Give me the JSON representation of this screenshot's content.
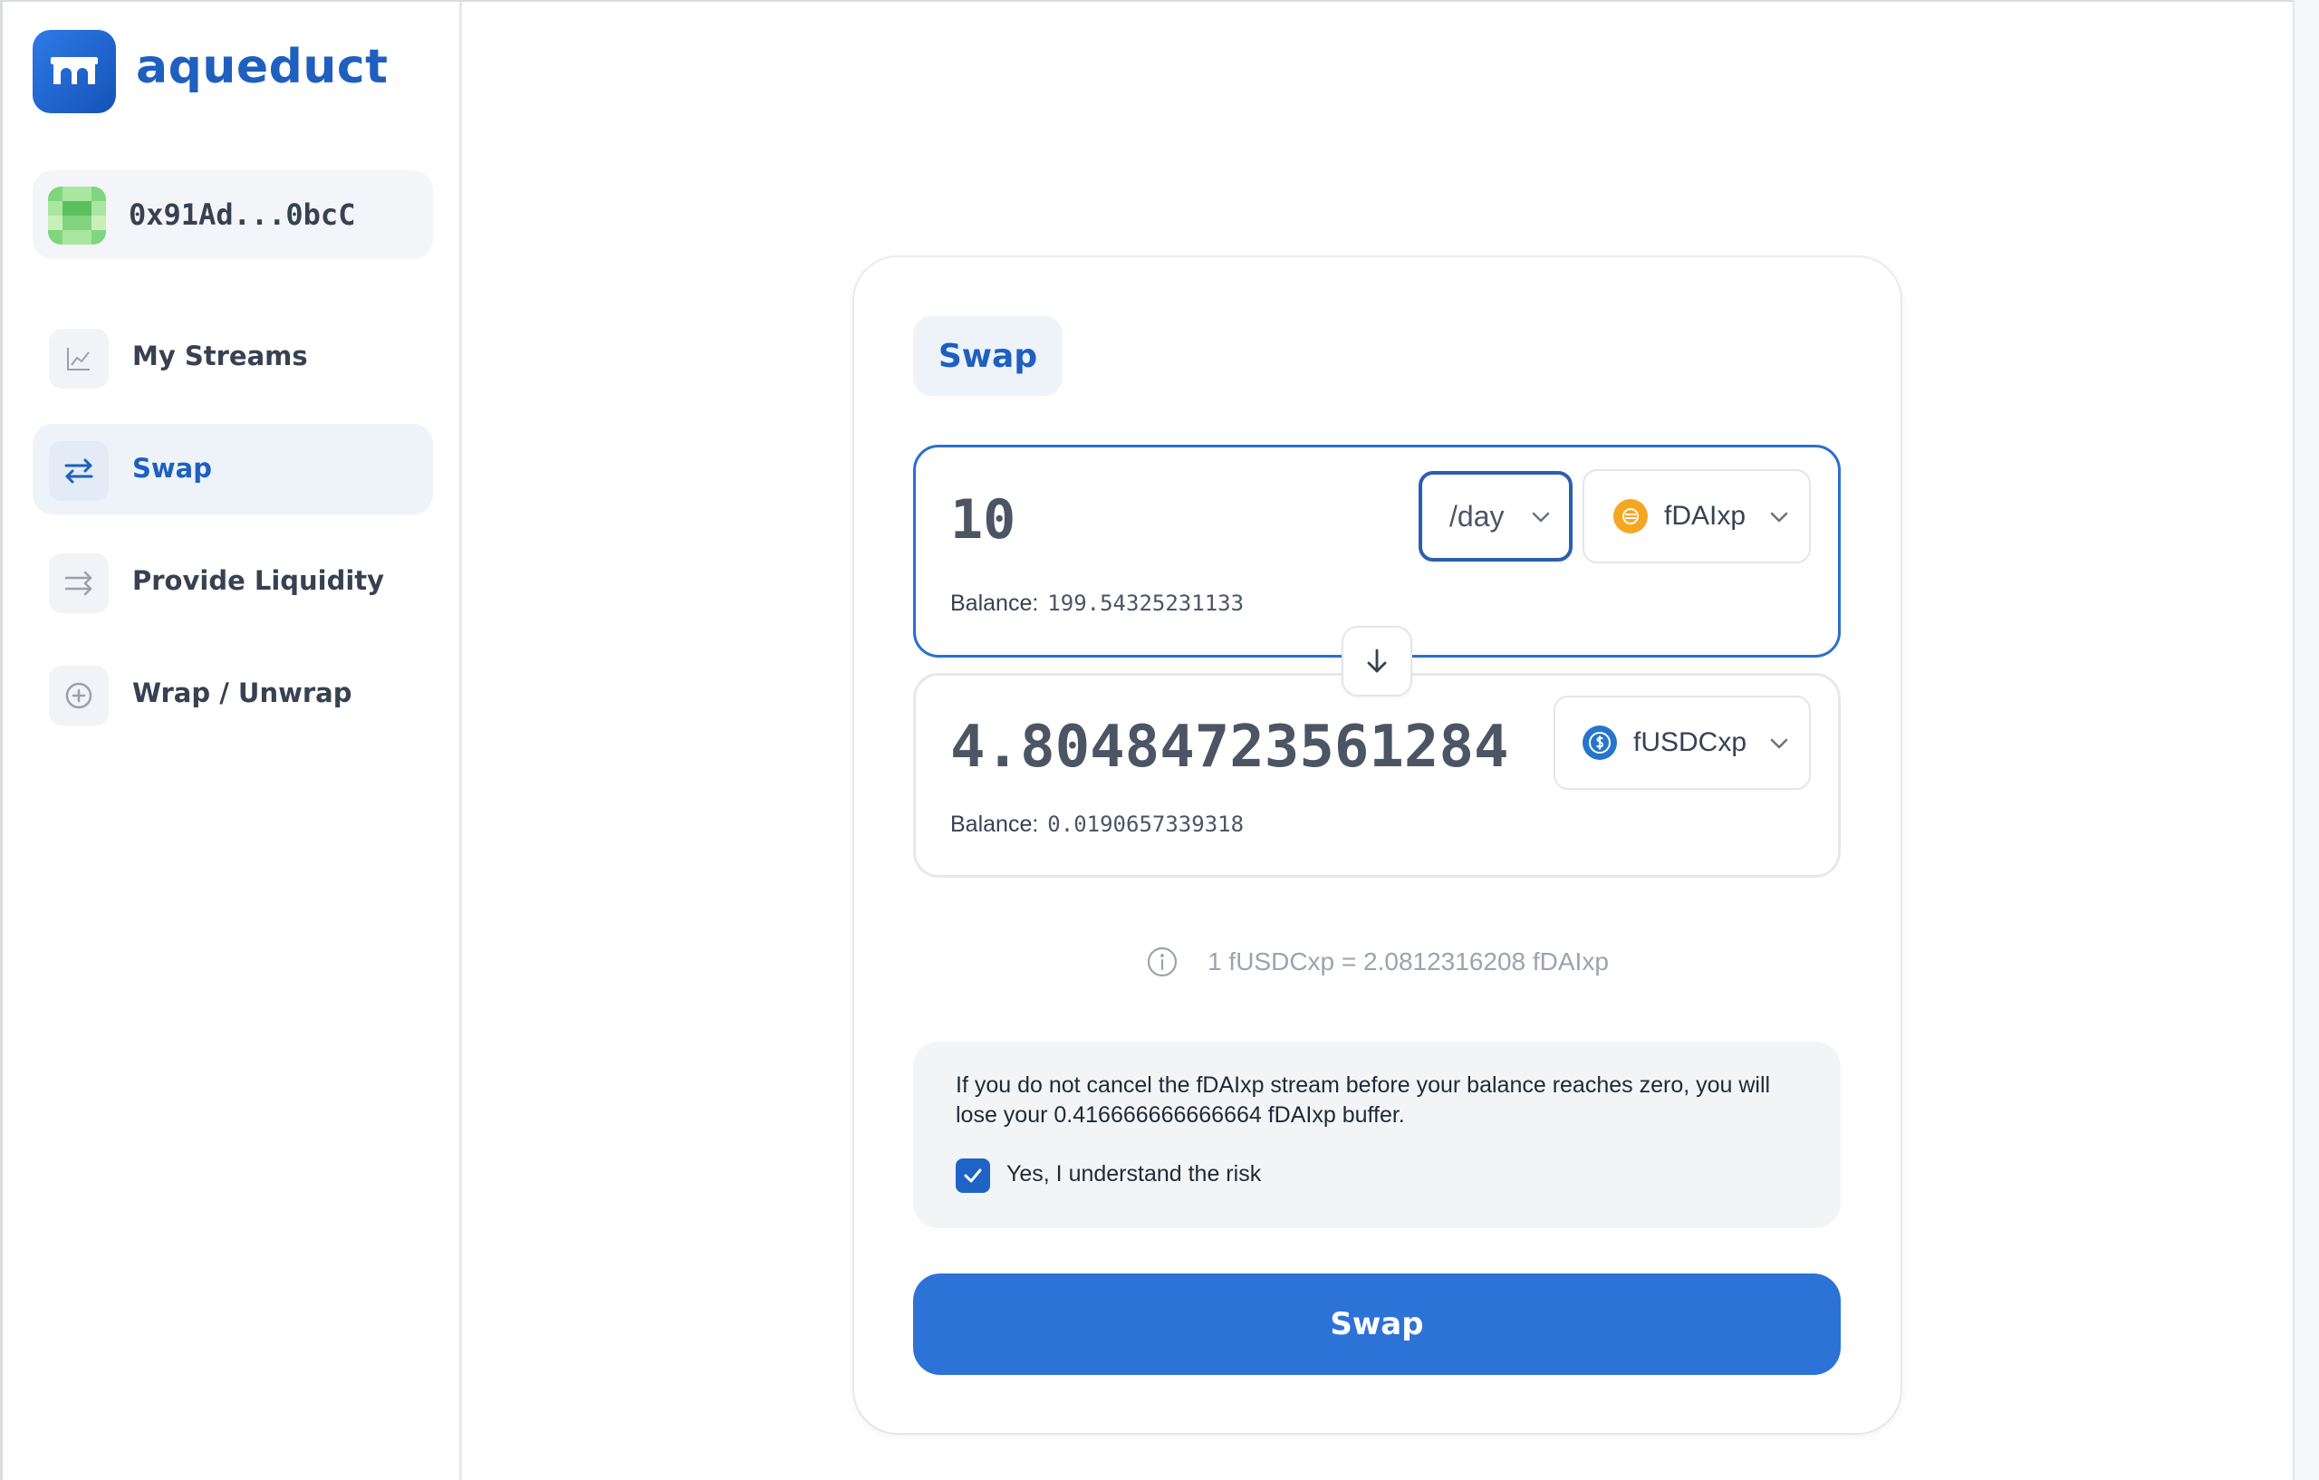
{
  "app": {
    "brand": "aqueduct",
    "brand_color": "#1f5fbf",
    "logo_icon": "aqueduct-bridge-logo"
  },
  "account": {
    "address": "0x91Ad...0bcC",
    "avatar_icon": "pixel-identicon"
  },
  "nav": {
    "items": [
      {
        "label": "My Streams",
        "icon": "chart-line-icon",
        "active": false
      },
      {
        "label": "Swap",
        "icon": "swap-arrows-icon",
        "active": true
      },
      {
        "label": "Provide Liquidity",
        "icon": "arrows-right-icon",
        "active": false
      },
      {
        "label": "Wrap / Unwrap",
        "icon": "plus-circle-icon",
        "active": false
      }
    ]
  },
  "swap": {
    "tab_label": "Swap",
    "from": {
      "amount": "10",
      "period": "/day",
      "token": "fDAIxp",
      "balance_label": "Balance:",
      "balance_value": "199.54325231133"
    },
    "to": {
      "amount": "4.80484723561284",
      "token": "fUSDCxp",
      "balance_label": "Balance:",
      "balance_value": "0.0190657339318"
    },
    "rate_text": "1 fUSDCxp = 2.0812316208 fDAIxp",
    "warning_text": "If you do not cancel the fDAIxp stream before your balance reaches zero, you will lose your 0.416666666666664 fDAIxp buffer.",
    "risk_checkbox_label": "Yes, I understand the risk",
    "risk_checked": true,
    "submit_label": "Swap"
  },
  "colors": {
    "accent": "#2d72d6",
    "dai_coin": "#f5a623",
    "usdc_coin": "#2775ca"
  }
}
